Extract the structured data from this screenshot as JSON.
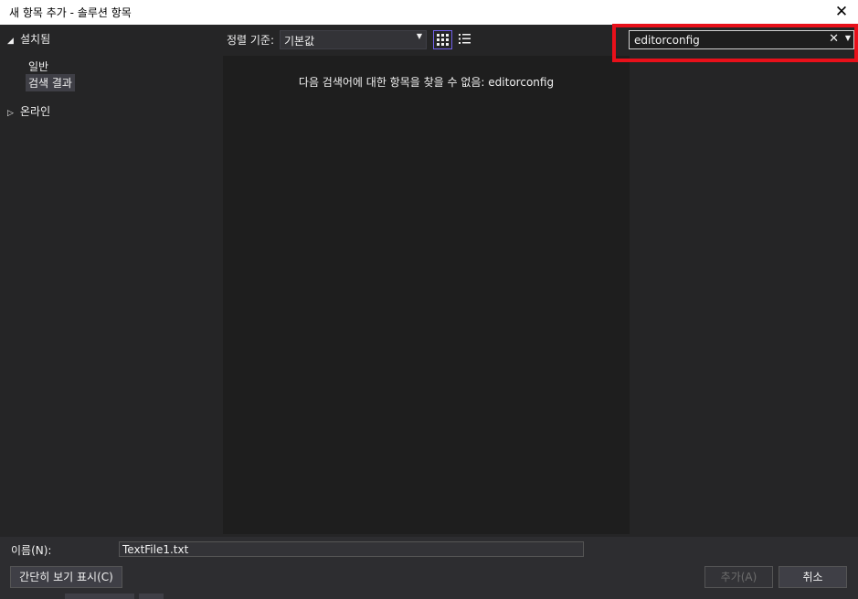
{
  "window": {
    "title": "새 항목 추가 - 솔루션 항목"
  },
  "tree": {
    "installed": {
      "label": "설치됨"
    },
    "children": [
      {
        "label": "일반"
      },
      {
        "label": "검색 결과"
      }
    ],
    "online": {
      "label": "온라인"
    }
  },
  "toolbar": {
    "sort_label": "정렬 기준:",
    "sort_value": "기본값"
  },
  "center": {
    "message": "다음 검색어에 대한 항목을 찾을 수 없음: editorconfig"
  },
  "search": {
    "value": "editorconfig"
  },
  "bottom": {
    "name_label": "이름(N):",
    "name_value": "TextFile1.txt",
    "compact_button": "간단히 보기 표시(C)",
    "add_button": "추가(A)",
    "cancel_button": "취소"
  },
  "colors": {
    "highlight": "#e8101a",
    "active_view": "#7160e8"
  }
}
